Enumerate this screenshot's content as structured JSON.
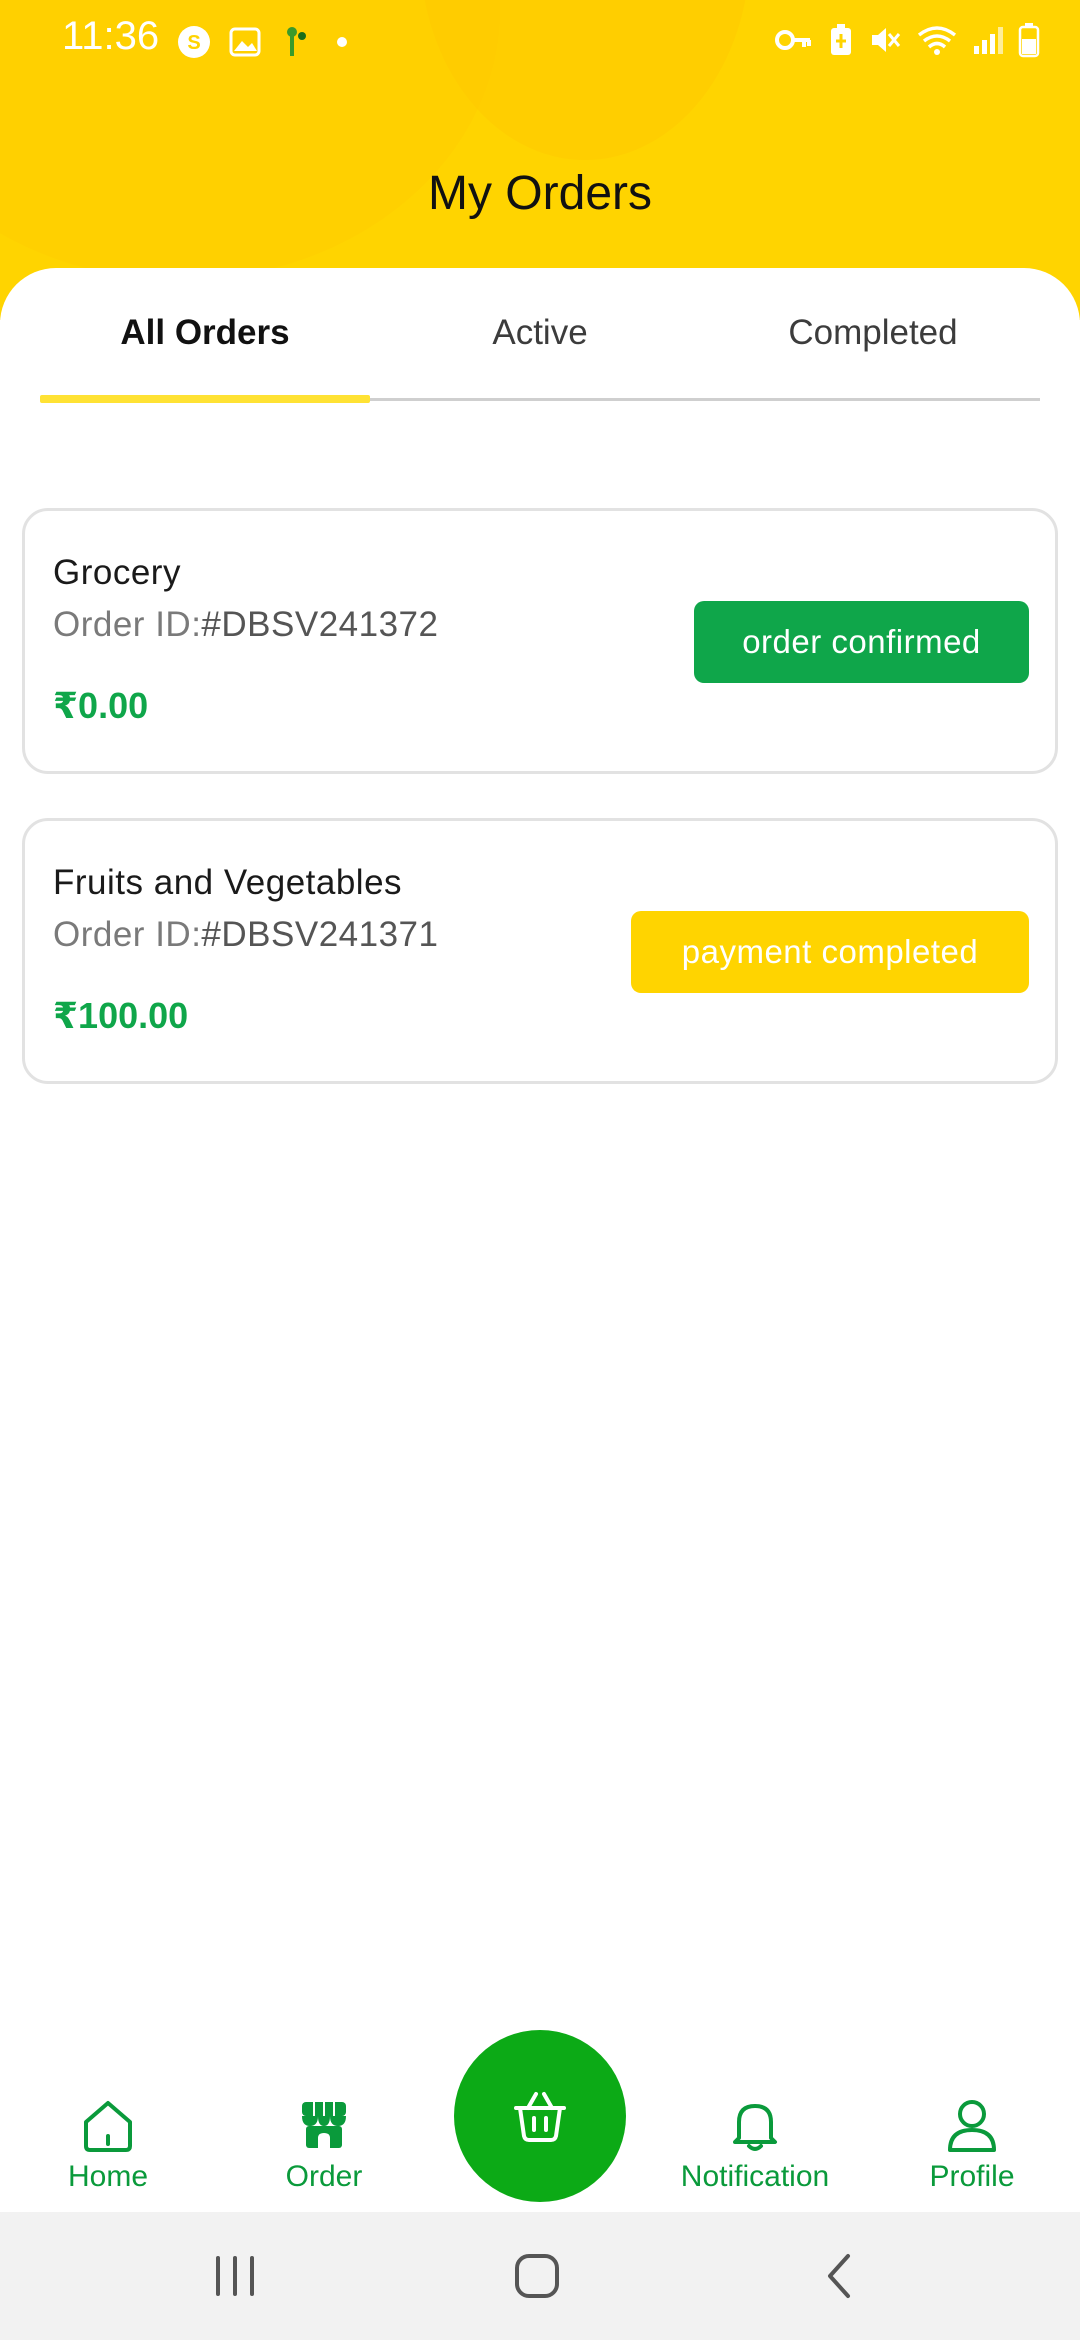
{
  "status_bar": {
    "time": "11:36",
    "left_icons": [
      "skype-icon",
      "gallery-icon",
      "app-icon",
      "dot-icon"
    ],
    "right_icons": [
      "vpn-key-icon",
      "battery-saver-icon",
      "mute-icon",
      "wifi-icon",
      "signal-icon",
      "battery-icon"
    ]
  },
  "header": {
    "title": "My Orders"
  },
  "tabs": [
    {
      "label": "All Orders",
      "active": true
    },
    {
      "label": "Active",
      "active": false
    },
    {
      "label": "Completed",
      "active": false
    }
  ],
  "orders": [
    {
      "category": "Grocery",
      "id_prefix": "Order ID:",
      "id_value": "#DBSV241372",
      "amount": "₹0.00",
      "status": "order confirmed",
      "status_color": "#0FA64A"
    },
    {
      "category": "Fruits and Vegetables",
      "id_prefix": "Order ID:",
      "id_value": "#DBSV241371",
      "amount": "₹100.00",
      "status": "payment completed",
      "status_color": "#FFD400"
    }
  ],
  "bottom_nav": {
    "home": "Home",
    "order": "Order",
    "center_icon": "basket-icon",
    "notification": "Notification",
    "profile": "Profile"
  },
  "colors": {
    "brand_yellow": "#FFD400",
    "brand_green": "#0FA64A",
    "fab_green": "#0CAA16"
  }
}
